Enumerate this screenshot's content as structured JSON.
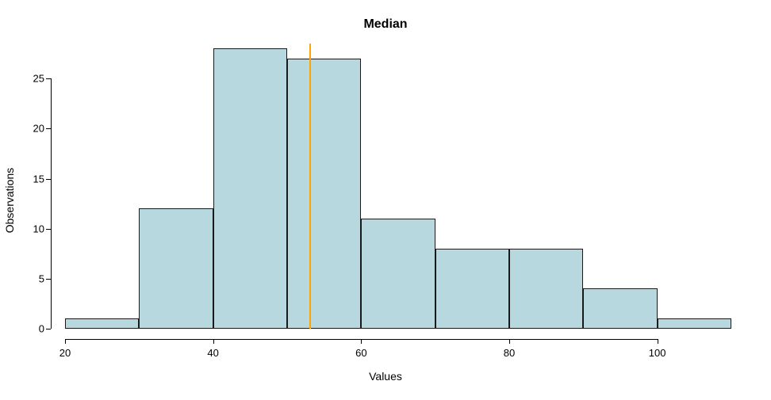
{
  "chart_data": {
    "type": "histogram",
    "title": "Median",
    "xlabel": "Values",
    "ylabel": "Observations",
    "bin_width": 10,
    "bin_edges": [
      20,
      30,
      40,
      50,
      60,
      70,
      80,
      90,
      100,
      110
    ],
    "values": [
      1,
      12,
      28,
      27,
      11,
      8,
      8,
      4,
      1
    ],
    "median_line_x": 53,
    "x_ticks": [
      20,
      40,
      60,
      80,
      100
    ],
    "y_ticks": [
      0,
      5,
      10,
      15,
      20,
      25
    ],
    "xlim": [
      20,
      110
    ],
    "ylim": [
      0,
      28.5
    ],
    "bar_fill": "#b8d8e0",
    "bar_border": "#1a1a1a",
    "median_color": "#ffa500"
  }
}
